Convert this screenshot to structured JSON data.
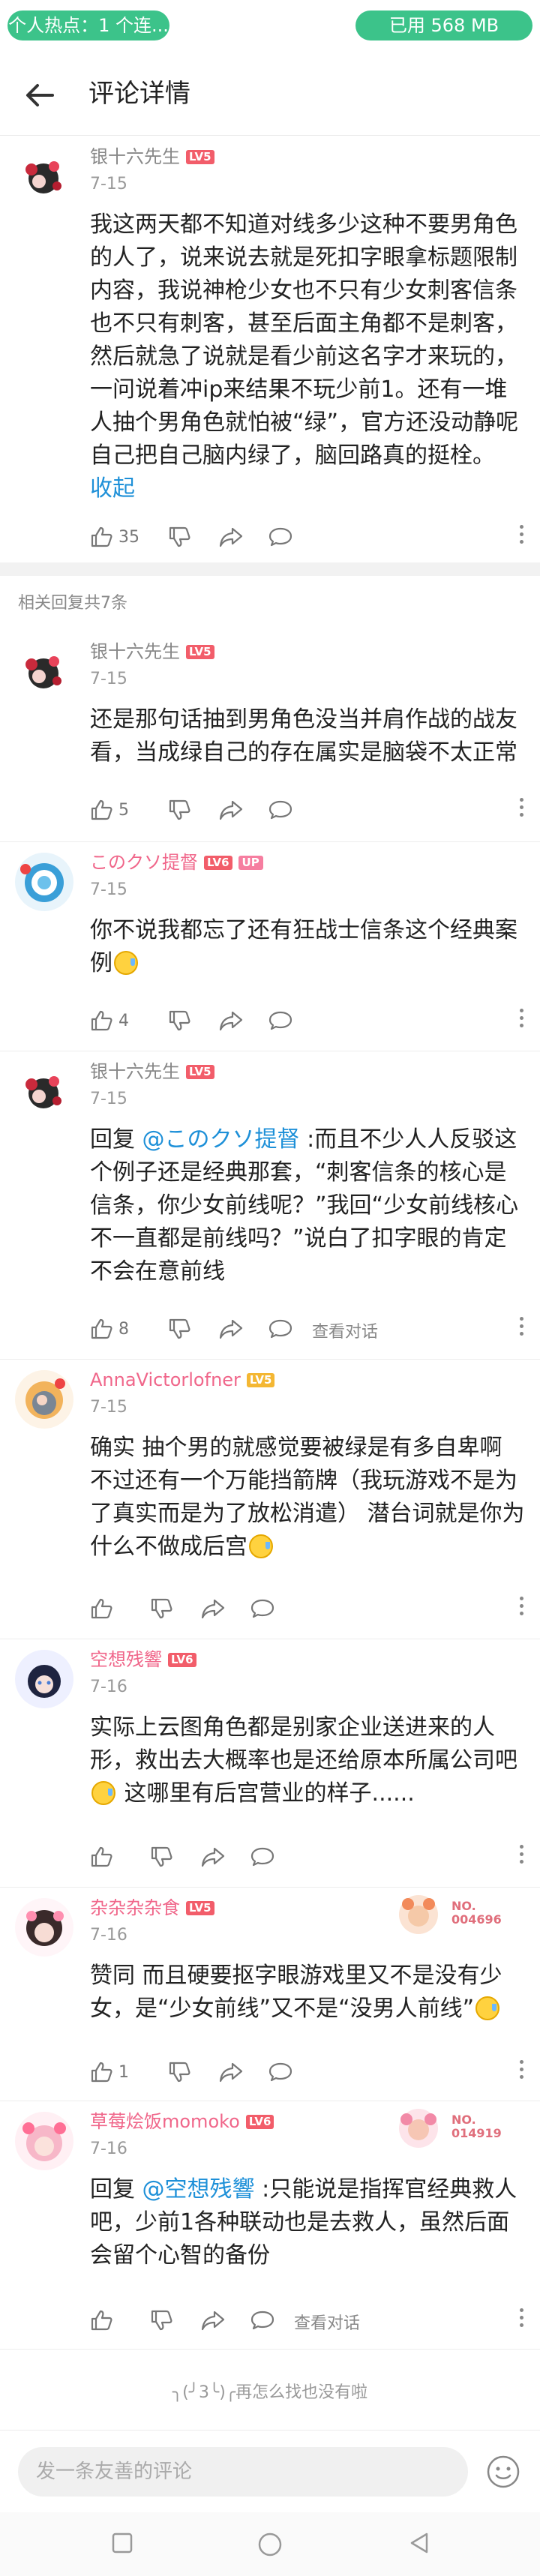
{
  "status_bar": {
    "left_pill": "个人热点：1 个连...",
    "right_pill": "已用 568 MB",
    "accent": "#3cc38a"
  },
  "header": {
    "title": "评论详情"
  },
  "main_comment": {
    "user": "银十六先生",
    "level": "LV5",
    "date": "7-15",
    "text": "我这两天都不知道对线多少这种不要男角色的人了，说来说去就是死扣字眼拿标题限制内容，我说神枪少女也不只有少女刺客信条也不只有刺客，甚至后面主角都不是刺客，然后就急了说就是看少前这名字才来玩的，一问说着冲ip来结果不玩少前1。还有一堆人抽个男角色就怕被“绿”，官方还没动静呢自己把自己脑内绿了，脑回路真的挺栓。",
    "collapse": "收起",
    "likes": "35"
  },
  "related_header": "相关回复共7条",
  "replies": [
    {
      "user": "银十六先生",
      "level": "LV5",
      "date": "7-15",
      "text": "还是那句话抽到男角色没当并肩作战的战友看，当成绿自己的存在属实是脑袋不太正常",
      "likes": "5"
    },
    {
      "user": "このクソ提督",
      "level": "LV6",
      "up": "UP",
      "date": "7-15",
      "text": "你不说我都忘了还有狂战士信条这个经典案例",
      "likes": "4"
    },
    {
      "user": "银十六先生",
      "level": "LV5",
      "date": "7-15",
      "reply_prefix": "回复 ",
      "mention": "@このクソ提督",
      "text": " :而且不少人人反驳这个例子还是经典那套，“刺客信条的核心是信条，你少女前线呢？”我回“少女前线核心不一直都是前线吗？”说白了扣字眼的肯定不会在意前线",
      "likes": "8",
      "view_conversation": "查看对话"
    },
    {
      "user": "AnnaVictorlofner",
      "level": "LV5",
      "date": "7-15",
      "text": "确实 抽个男的就感觉要被绿是有多自卑啊 不过还有一个万能挡箭牌（我玩游戏不是为了真实而是为了放松消遣） 潜台词就是你为什么不做成后宫"
    },
    {
      "user": "空想残響",
      "level": "LV6",
      "date": "7-16",
      "text_a": "实际上云图角色都是别家企业送进来的人形，救出去大概率也是还给原本所属公司吧",
      "text_b": "这哪里有后宫营业的样子......"
    },
    {
      "user": "杂杂杂杂食",
      "level": "LV5",
      "date": "7-16",
      "badge": "NO. 004696",
      "text": "赞同 而且硬要抠字眼游戏里又不是没有少女，是“少女前线”又不是“没男人前线”",
      "likes": "1"
    },
    {
      "user": "草莓烩饭momoko",
      "level": "LV6",
      "date": "7-16",
      "badge": "NO. 014919",
      "reply_prefix": "回复 ",
      "mention": "@空想残響",
      "text": " :只能说是指挥官经典救人吧，少前1各种联动也是去救人，虽然后面会留个心智的备份",
      "view_conversation": "查看对话"
    }
  ],
  "end_text": "╮(╯3╰)╭再怎么找也没有啦",
  "input": {
    "placeholder": "发一条友善的评论"
  }
}
